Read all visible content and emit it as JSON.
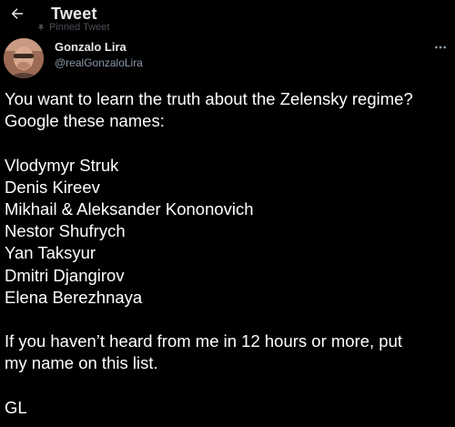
{
  "header": {
    "title": "Tweet",
    "back_icon": "arrow-left-icon"
  },
  "pinned": {
    "label": "Pinned Tweet",
    "icon": "pin-icon"
  },
  "author": {
    "display_name": "Gonzalo Lira",
    "handle": "@realGonzaloLira",
    "more_icon": "more-options-icon"
  },
  "tweet": {
    "intro_line1": "You want to learn the truth about the Zelensky regime?",
    "intro_line2": "Google these names:",
    "names": [
      "Vlodymyr Struk",
      "Denis Kireev",
      "Mikhail & Aleksander Kononovich",
      "Nestor Shufrych",
      "Yan Taksyur",
      "Dmitri Djangirov",
      "Elena Berezhnaya"
    ],
    "outro_line1": "If you haven’t heard from me in 12 hours or more, put",
    "outro_line2": "my name on this list.",
    "signoff": "GL"
  },
  "colors": {
    "background": "#000000",
    "text_primary": "#e7e9ea",
    "text_secondary": "#8b98a5"
  }
}
